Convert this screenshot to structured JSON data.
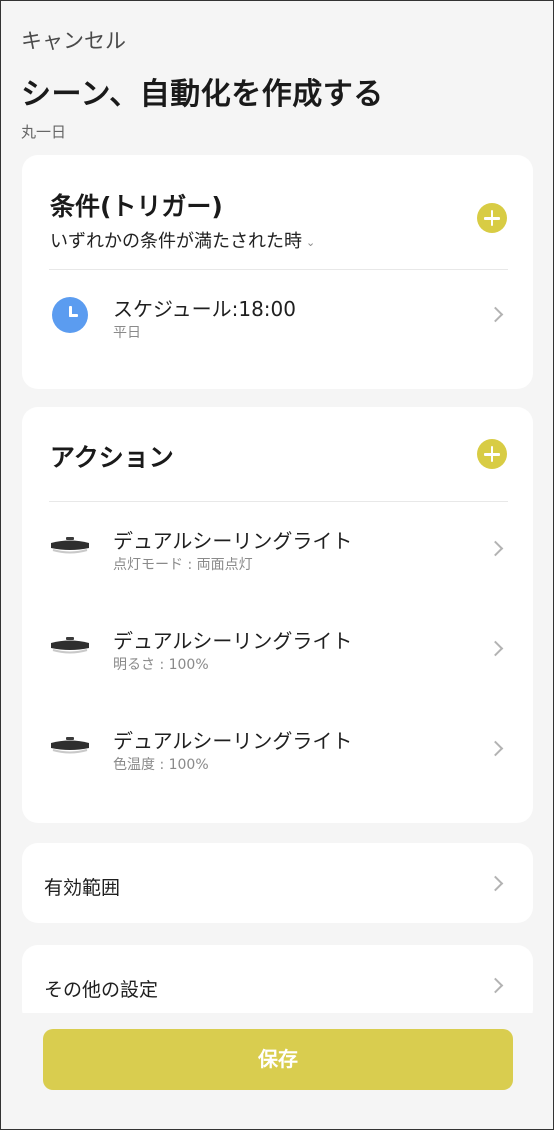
{
  "header": {
    "cancel_label": "キャンセル",
    "title": "シーン、自動化を作成する",
    "home_name": "丸一日"
  },
  "trigger": {
    "title": "条件(トリガー)",
    "condition_mode": "いずれかの条件が満たされた時",
    "items": [
      {
        "icon": "clock-icon",
        "title": "スケジュール:18:00",
        "subtitle": "平日"
      }
    ]
  },
  "action": {
    "title": "アクション",
    "items": [
      {
        "icon": "ceiling-light-icon",
        "title": "デュアルシーリングライト",
        "subtitle": "点灯モード : 両面点灯"
      },
      {
        "icon": "ceiling-light-icon",
        "title": "デュアルシーリングライト",
        "subtitle": "明るさ : 100%"
      },
      {
        "icon": "ceiling-light-icon",
        "title": "デュアルシーリングライト",
        "subtitle": "色温度 : 100%"
      }
    ]
  },
  "scope": {
    "label": "有効範囲"
  },
  "other": {
    "label": "その他の設定"
  },
  "footer": {
    "save_label": "保存"
  },
  "colors": {
    "accent": "#d9cd4f",
    "clock_icon": "#5b9cf0",
    "background": "#f5f5f5",
    "card": "#ffffff"
  }
}
